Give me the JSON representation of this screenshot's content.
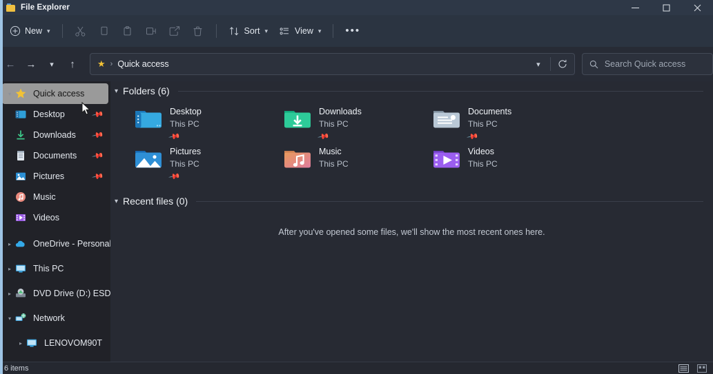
{
  "window": {
    "title": "File Explorer",
    "app_icon": "folder-icon",
    "controls": [
      {
        "name": "minimize",
        "glyph": "–"
      },
      {
        "name": "maximize",
        "glyph": "☐"
      },
      {
        "name": "close",
        "glyph": "✕"
      }
    ]
  },
  "toolbar": {
    "new_label": "New",
    "sort_label": "Sort",
    "view_label": "View",
    "items": [
      {
        "name": "new-button",
        "icon": "plus-circle-icon",
        "label": "New",
        "has_chevron": true,
        "enabled": true
      },
      {
        "name": "cut-button",
        "icon": "scissors-icon",
        "label": "",
        "enabled": false
      },
      {
        "name": "copy-button",
        "icon": "copy-icon",
        "label": "",
        "enabled": false
      },
      {
        "name": "paste-button",
        "icon": "paste-icon",
        "label": "",
        "enabled": false
      },
      {
        "name": "rename-button",
        "icon": "rename-icon",
        "label": "",
        "enabled": false
      },
      {
        "name": "share-button",
        "icon": "share-icon",
        "label": "",
        "enabled": false
      },
      {
        "name": "delete-button",
        "icon": "trash-icon",
        "label": "",
        "enabled": false
      },
      {
        "name": "sort-button",
        "icon": "sort-icon",
        "label": "Sort",
        "has_chevron": true,
        "enabled": true
      },
      {
        "name": "view-button",
        "icon": "view-list-icon",
        "label": "View",
        "has_chevron": true,
        "enabled": true
      },
      {
        "name": "see-more-button",
        "icon": "ellipsis-icon",
        "label": "",
        "enabled": true
      }
    ]
  },
  "address": {
    "back_icon": "arrow-left-icon",
    "forward_icon": "arrow-right-icon",
    "recent_icon": "chevron-down-icon",
    "up_icon": "arrow-up-icon",
    "crumb_icon": "star-icon",
    "crumb_separator": "›",
    "crumb_text": "Quick access",
    "dropdown_icon": "chevron-down-icon",
    "refresh_icon": "refresh-icon"
  },
  "search": {
    "icon": "search-icon",
    "placeholder": "Search Quick access",
    "value": ""
  },
  "sidebar": {
    "items": [
      {
        "label": "Quick access",
        "icon": "star-icon",
        "expandable": true,
        "expanded": true,
        "selected": true,
        "pinned": false,
        "indent": false
      },
      {
        "label": "Desktop",
        "icon": "desktop-folder-icon",
        "expandable": false,
        "expanded": false,
        "selected": false,
        "pinned": true,
        "indent": false
      },
      {
        "label": "Downloads",
        "icon": "downloads-icon",
        "expandable": false,
        "expanded": false,
        "selected": false,
        "pinned": true,
        "indent": false
      },
      {
        "label": "Documents",
        "icon": "documents-icon",
        "expandable": false,
        "expanded": false,
        "selected": false,
        "pinned": true,
        "indent": false
      },
      {
        "label": "Pictures",
        "icon": "pictures-icon",
        "expandable": false,
        "expanded": false,
        "selected": false,
        "pinned": true,
        "indent": false
      },
      {
        "label": "Music",
        "icon": "music-icon",
        "expandable": false,
        "expanded": false,
        "selected": false,
        "pinned": false,
        "indent": false
      },
      {
        "label": "Videos",
        "icon": "videos-icon",
        "expandable": false,
        "expanded": false,
        "selected": false,
        "pinned": false,
        "indent": false
      },
      {
        "label": "OneDrive - Personal",
        "icon": "onedrive-icon",
        "expandable": true,
        "expanded": false,
        "selected": false,
        "pinned": false,
        "indent": false
      },
      {
        "label": "This PC",
        "icon": "this-pc-icon",
        "expandable": true,
        "expanded": false,
        "selected": false,
        "pinned": false,
        "indent": false
      },
      {
        "label": "DVD Drive (D:) ESD-ISO",
        "icon": "dvd-drive-icon",
        "expandable": true,
        "expanded": false,
        "selected": false,
        "pinned": false,
        "indent": false
      },
      {
        "label": "Network",
        "icon": "network-icon",
        "expandable": true,
        "expanded": true,
        "selected": false,
        "pinned": false,
        "indent": false
      },
      {
        "label": "LENOVOM90T",
        "icon": "computer-icon",
        "expandable": true,
        "expanded": false,
        "selected": false,
        "pinned": false,
        "indent": true
      }
    ]
  },
  "main": {
    "folders_section": {
      "title": "Folders (6)",
      "chevron": "chevron-down-icon",
      "tiles": [
        {
          "name": "Desktop",
          "location": "This PC",
          "icon": "desktop-folder-icon",
          "pinned": true
        },
        {
          "name": "Downloads",
          "location": "This PC",
          "icon": "downloads-folder-icon",
          "pinned": true
        },
        {
          "name": "Documents",
          "location": "This PC",
          "icon": "documents-folder-icon",
          "pinned": true
        },
        {
          "name": "Pictures",
          "location": "This PC",
          "icon": "pictures-folder-icon",
          "pinned": true
        },
        {
          "name": "Music",
          "location": "This PC",
          "icon": "music-folder-icon",
          "pinned": false
        },
        {
          "name": "Videos",
          "location": "This PC",
          "icon": "videos-folder-icon",
          "pinned": false
        }
      ]
    },
    "recent_section": {
      "title": "Recent files (0)",
      "chevron": "chevron-down-icon",
      "empty_message": "After you've opened some files, we'll show the most recent ones here."
    }
  },
  "statusbar": {
    "items_count": "6 items",
    "view_buttons": [
      {
        "name": "details-view-button",
        "icon": "details-view-icon"
      },
      {
        "name": "large-icons-view-button",
        "icon": "large-icons-view-icon"
      }
    ]
  },
  "colors": {
    "titlebar": "#2e3847",
    "toolbar": "#2b3441",
    "sidebar": "#212228",
    "content": "#272a33",
    "accent": "#4cc2ff",
    "star": "#f2c235",
    "selection": "#9a9a9a"
  }
}
